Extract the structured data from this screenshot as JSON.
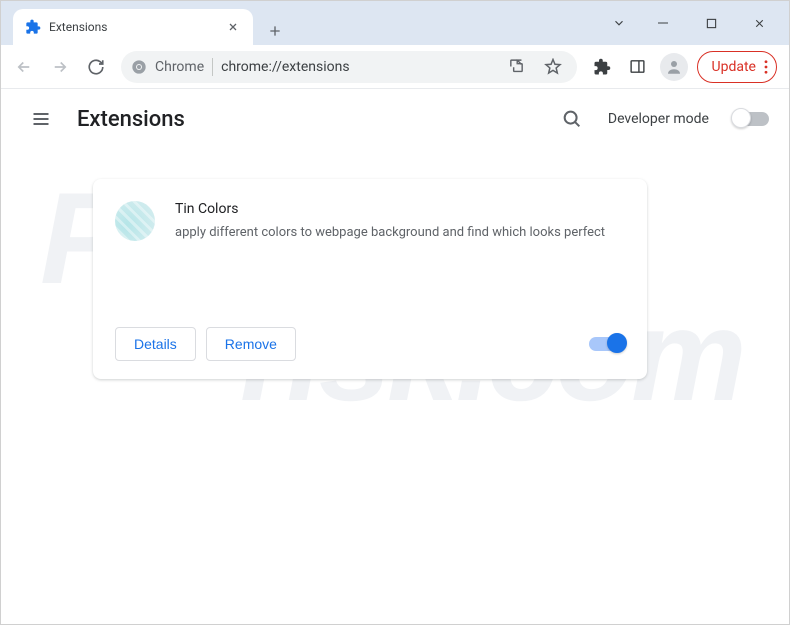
{
  "tab": {
    "title": "Extensions"
  },
  "omnibox": {
    "prefix": "Chrome",
    "url": "chrome://extensions"
  },
  "update": {
    "label": "Update"
  },
  "page": {
    "title": "Extensions",
    "dev_mode_label": "Developer mode",
    "dev_mode_on": false
  },
  "extension": {
    "name": "Tin Colors",
    "description": "apply different colors to webpage background and find which looks perfect",
    "details_label": "Details",
    "remove_label": "Remove",
    "enabled": true
  },
  "watermark": {
    "line1": "PC",
    "line2": "risk.com"
  }
}
